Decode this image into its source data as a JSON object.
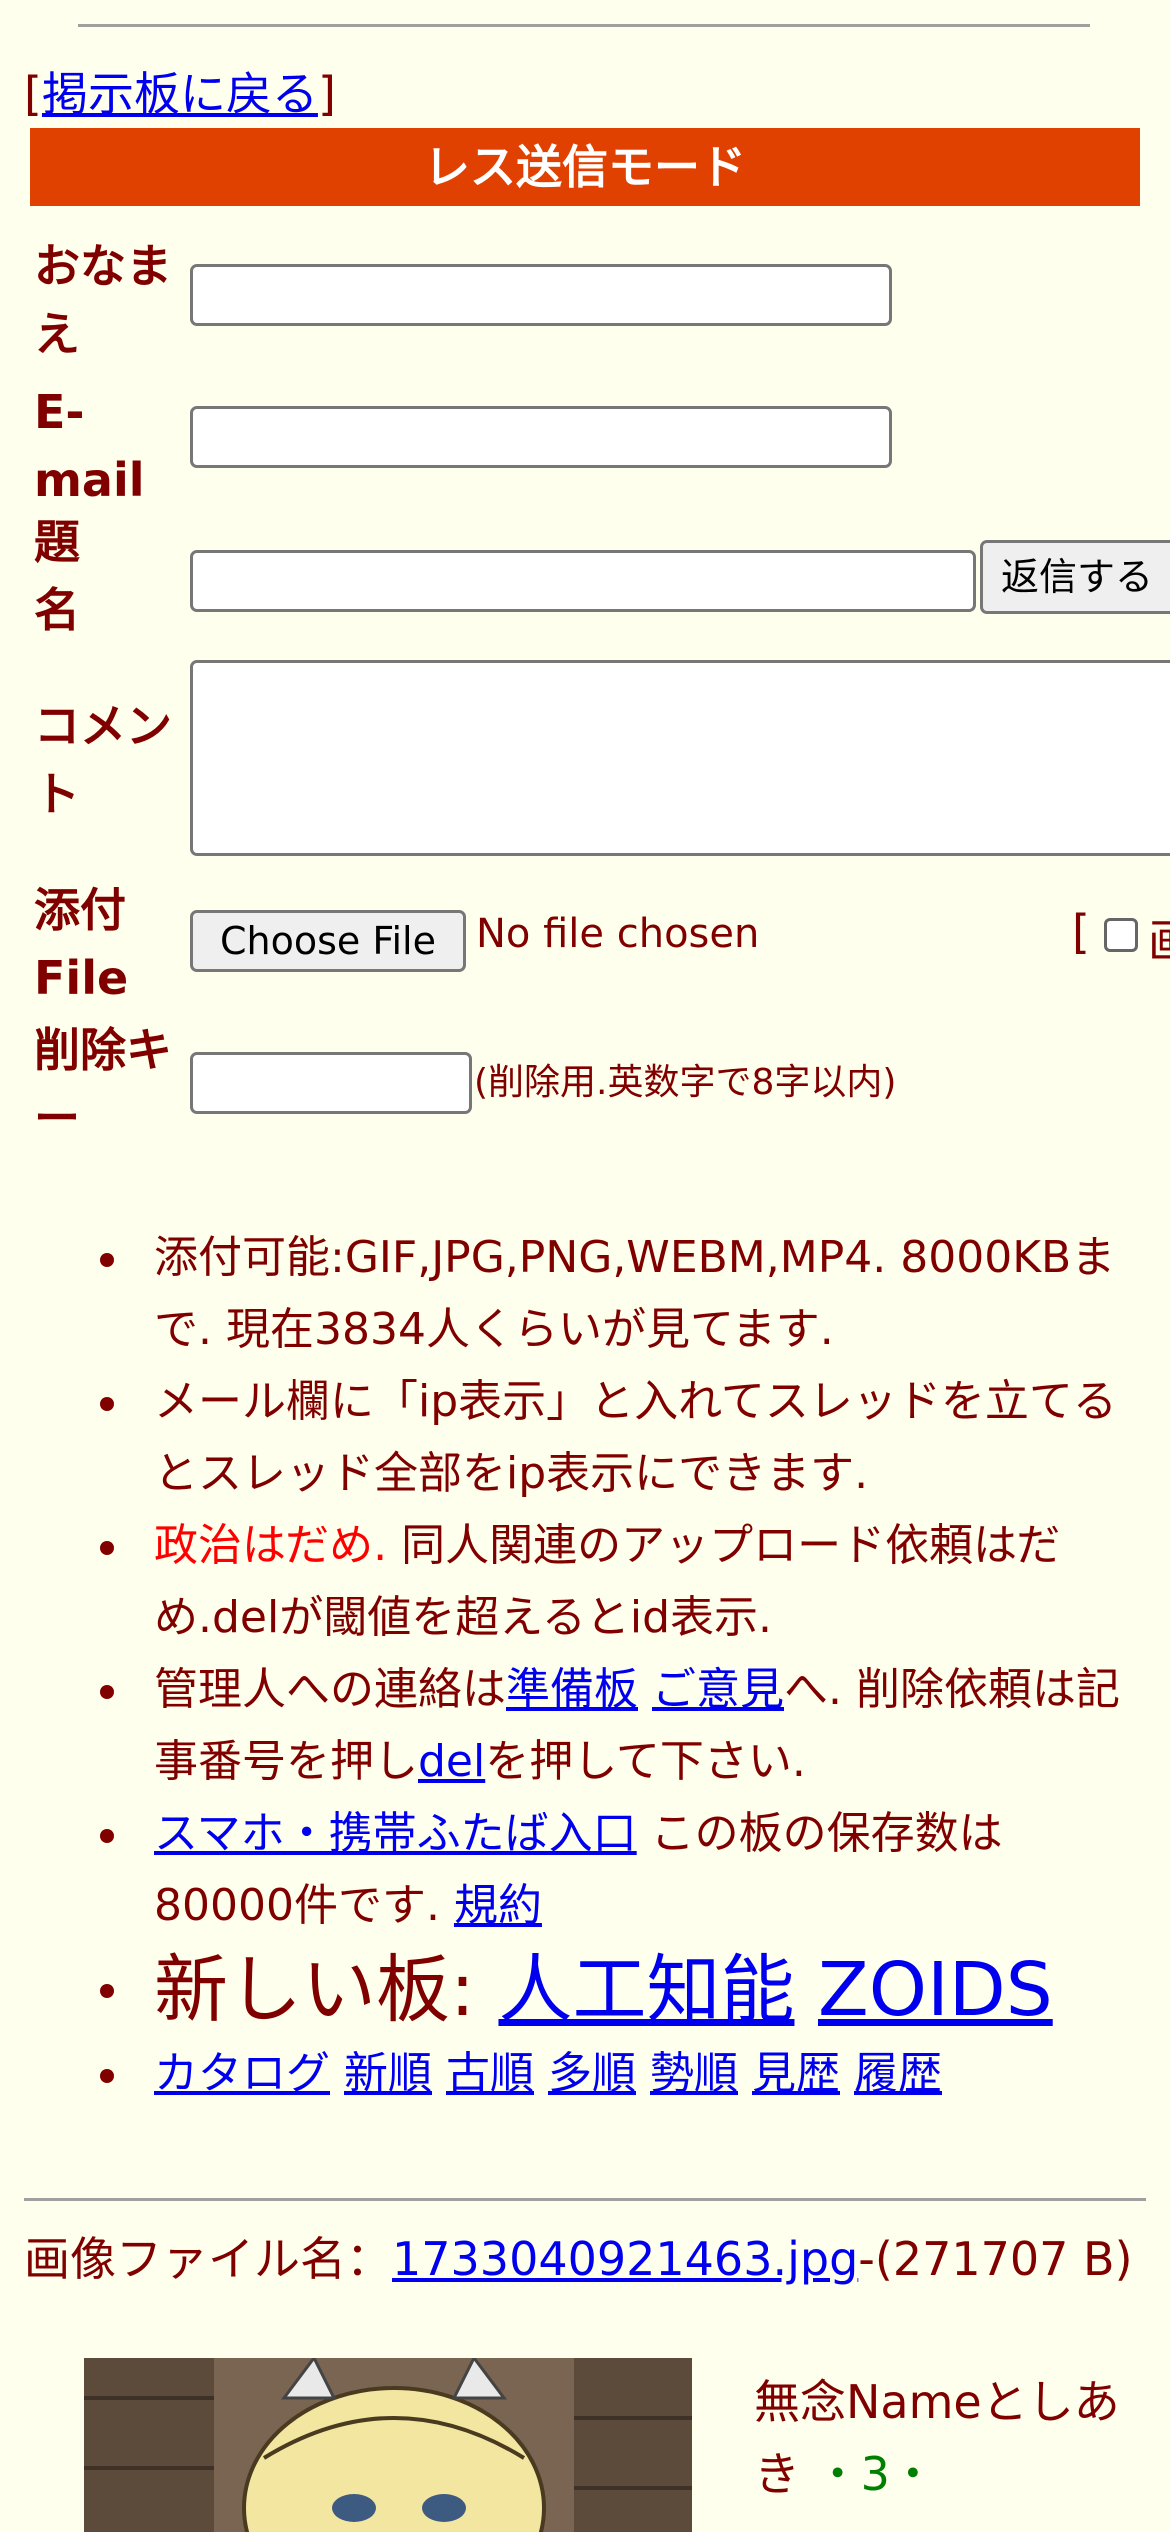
{
  "nav": {
    "back_prefix": "[",
    "back_link": "掲示板に戻る",
    "back_suffix": "]"
  },
  "mode_title": "レス送信モード",
  "form": {
    "name_label": "おなまえ",
    "email_label": "E-mail",
    "subject_label": "題名",
    "submit_label": "返信する",
    "comment_label": "コメント",
    "file_label": "添付File",
    "choose_file_label": "Choose File",
    "file_status": "No file chosen",
    "image_option_bracket": "[",
    "image_option_partial": "画",
    "delkey_label": "削除キー",
    "delkey_hint": "(削除用.英数字で8字以内)"
  },
  "rules": {
    "r1": "添付可能:GIF,JPG,PNG,WEBM,MP4. 8000KBまで. 現在3834人くらいが見てます.",
    "r2": "メール欄に「ip表示」と入れてスレッドを立てるとスレッド全部をip表示にできます.",
    "r3_red": "政治はだめ.",
    "r3_rest": " 同人関連のアップロード依頼はだめ.delが閾値を超えるとid表示.",
    "r4_a": "管理人への連絡は",
    "r4_link1": "準備板",
    "r4_link2": "ご意見",
    "r4_b": "へ. 削除依頼は記事番号を押し",
    "r4_link3": "del",
    "r4_c": "を押して下さい.",
    "r5_link": "スマホ・携帯ふたば入口",
    "r5_a": " この板の保存数は80000件です. ",
    "r5_link2": "規約",
    "new_boards_label": "新しい板: ",
    "new_board_1": "人工知能",
    "new_board_2": "ZOIDS",
    "catalog_links": [
      "カタログ",
      "新順",
      "古順",
      "多順",
      "勢順",
      "見歴",
      "履歴"
    ]
  },
  "post": {
    "file_prefix": "画像ファイル名：",
    "file_name": "1733040921463.jpg",
    "file_size": "-(271707 B)",
    "poster_name": "無念Nameとしあき",
    "poster_score": "・3・"
  }
}
